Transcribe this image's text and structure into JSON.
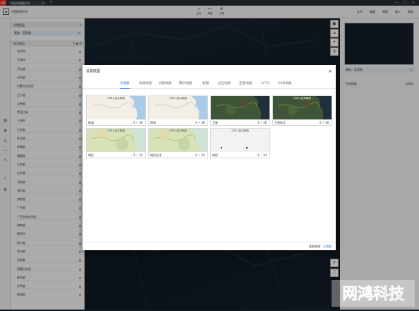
{
  "titlebar": {
    "logo": "超图",
    "tab_label": "用去系地图平台",
    "tab_close": "×",
    "new_tab": "+",
    "minimize": "—",
    "maximize": "□",
    "close": "×"
  },
  "header": {
    "app_title": "中国地图平台",
    "tools": [
      {
        "icon": "search-icon",
        "label": "定位"
      },
      {
        "icon": "measure-icon",
        "label": "测距"
      },
      {
        "icon": "tool-icon",
        "label": "工具"
      }
    ],
    "menu": [
      "文件",
      "编辑",
      "视图",
      "插入",
      "帮助"
    ]
  },
  "layers_panel": {
    "section1_title": "设置图层",
    "section1_add": "+",
    "active_layer": "基础 - 蓝背景",
    "active_layer_close": "×",
    "section2_title": "标注图层",
    "regions": [
      "北京市",
      "天津市",
      "河北省",
      "山西省",
      "内蒙古自治区",
      "辽宁省",
      "吉林省",
      "黑龙江省",
      "上海市",
      "江苏省",
      "浙江省",
      "安徽省",
      "福建省",
      "江西省",
      "山东省",
      "河南省",
      "湖北省",
      "湖南省",
      "广东省",
      "广西壮族自治区",
      "海南省",
      "重庆市",
      "四川省",
      "贵州省",
      "云南省",
      "西藏自治区",
      "陕西省",
      "甘肃省",
      "青海省"
    ]
  },
  "right_panel": {
    "layer_name": "基础 - 蓝背景",
    "layer_close": "×",
    "opacity_label": "不透明度",
    "opacity_value": "100%"
  },
  "modal": {
    "title": "设置底图",
    "close": "×",
    "tabs": [
      "天地图",
      "高德地图",
      "谷歌地图",
      "腾讯地图",
      "智图",
      "必应地图",
      "百度地图",
      "CCTS",
      "OSM地图"
    ],
    "active_tab": 0,
    "cards": [
      {
        "name": "街道",
        "zoom": "3 ~ 18",
        "style": "street",
        "map_label": "中华人民共和国"
      },
      {
        "name": "简单",
        "zoom": "3 ~ 18",
        "style": "street",
        "map_label": "中华人民共和国"
      },
      {
        "name": "卫星",
        "zoom": "3 ~ 18",
        "style": "satellite",
        "map_label": ""
      },
      {
        "name": "卫星标注",
        "zoom": "3 ~ 18",
        "style": "satellite",
        "map_label": "中华人民共和国"
      },
      {
        "name": "地形",
        "zoom": "3 ~ 14",
        "style": "terrain",
        "map_label": "中华人民共和国"
      },
      {
        "name": "地形标注",
        "zoom": "3 ~ 14",
        "style": "terrain",
        "map_label": "中华人民共和国"
      },
      {
        "name": "地形",
        "zoom": "3 ~ 14",
        "style": "blank",
        "map_label": "中华人民共和国"
      }
    ],
    "footer_label": "底图来源：",
    "footer_link": "天地图"
  },
  "watermark": "网鸿科技",
  "colors": {
    "accent": "#2b6fd6",
    "map_bg": "#121c26",
    "street_land": "#f3efe6",
    "street_water": "#a9cbe8",
    "satellite": "#3f5537",
    "terrain": "#d7e2b8"
  }
}
